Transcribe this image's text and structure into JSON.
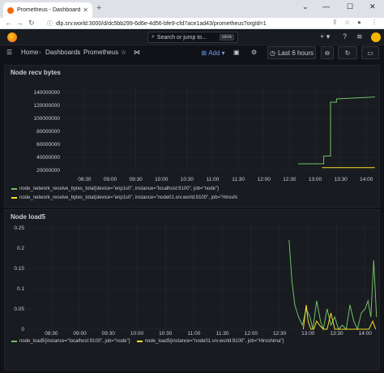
{
  "browser": {
    "tab_title": "Prometheus - Dashboards - Graf",
    "url": "dlp.srv.world:3000/d/dc5bb299-6d6e-4d56-bfe9-cfd7ace1ad43/prometheus?orgId=1"
  },
  "topbar": {
    "search_placeholder": "Search or jump to...",
    "search_shortcut": "ctrl+k"
  },
  "navbar": {
    "breadcrumb_home": "Home",
    "breadcrumb_dashboards": "Dashboards",
    "breadcrumb_current": "Prometheus",
    "add_label": "Add",
    "time_range": "Last 6 hours"
  },
  "panels": [
    {
      "title": "Node recv bytes",
      "legend": [
        "node_network_receive_bytes_total{device=\"enp1s0\", instance=\"localhost:9100\", job=\"node\"}",
        "node_network_receive_bytes_total{device=\"enp1s0\", instance=\"node01.srv.world:9100\", job=\"Hiroshi"
      ]
    },
    {
      "title": "Node load5",
      "legend": [
        "node_load5{instance=\"localhost:9100\", job=\"node\"}",
        "node_load5{instance=\"node01.srv.world:9100\", job=\"Hiroshima\"}"
      ]
    }
  ],
  "colors": {
    "series_green": "#73bf69",
    "series_yellow": "#fade2a",
    "accent": "#6e9fff"
  },
  "chart_data": [
    {
      "type": "line",
      "title": "Node recv bytes",
      "x_ticks": [
        "08:30",
        "09:00",
        "09:30",
        "10:00",
        "10:30",
        "11:00",
        "11:30",
        "12:00",
        "12:30",
        "13:00",
        "13:30",
        "14:00"
      ],
      "y_ticks": [
        "20000000",
        "40000000",
        "60000000",
        "80000000",
        "100000000",
        "120000000",
        "140000000"
      ],
      "ylim": [
        13000000,
        145000000
      ],
      "xlim": [
        "08:05",
        "14:13"
      ],
      "series": [
        {
          "name": "node_network_receive_bytes_total{device=\"enp1s0\", instance=\"localhost:9100\", job=\"node\"}",
          "color": "#73bf69",
          "x": [
            "12:40",
            "13:10",
            "13:10",
            "13:18",
            "13:18",
            "13:25",
            "13:25",
            "14:10"
          ],
          "values": [
            30000000,
            30000000,
            42000000,
            42000000,
            125000000,
            125000000,
            130000000,
            133000000
          ]
        },
        {
          "name": "node_network_receive_bytes_total{device=\"enp1s0\", instance=\"node01.srv.world:9100\", job=\"Hiroshi",
          "color": "#fade2a",
          "x": [
            "13:08",
            "14:10"
          ],
          "values": [
            24000000,
            24000000
          ]
        }
      ]
    },
    {
      "type": "line",
      "title": "Node load5",
      "x_ticks": [
        "08:30",
        "09:00",
        "09:30",
        "10:00",
        "10:30",
        "11:00",
        "11:30",
        "12:00",
        "12:30",
        "13:00",
        "13:30",
        "14:00"
      ],
      "y_ticks": [
        "0",
        "0.05",
        "0.1",
        "0.15",
        "0.2",
        "0.25"
      ],
      "ylim": [
        0,
        0.25
      ],
      "xlim": [
        "08:05",
        "14:13"
      ],
      "series": [
        {
          "name": "node_load5{instance=\"localhost:9100\", job=\"node\"}",
          "color": "#73bf69",
          "x": [
            "12:40",
            "12:43",
            "12:46",
            "12:50",
            "12:54",
            "12:58",
            "13:02",
            "13:05",
            "13:09",
            "13:13",
            "13:16",
            "13:20",
            "13:24",
            "13:28",
            "13:32",
            "13:36",
            "13:40",
            "13:44",
            "13:48",
            "13:52",
            "13:56",
            "14:00",
            "14:03",
            "14:06",
            "14:09",
            "14:12"
          ],
          "values": [
            0.22,
            0.12,
            0.06,
            0.03,
            0.01,
            0.05,
            0.03,
            0.0,
            0.07,
            0.02,
            0.0,
            0.05,
            0.01,
            0.03,
            0.0,
            0.01,
            0.0,
            0.06,
            0.02,
            0.0,
            0.04,
            0.05,
            0.07,
            0.03,
            0.17,
            0.03
          ]
        },
        {
          "name": "node_load5{instance=\"node01.srv.world:9100\", job=\"Hiroshima\"}",
          "color": "#fade2a",
          "x": [
            "12:55",
            "12:58",
            "13:00",
            "13:03",
            "13:06",
            "13:09",
            "13:12",
            "13:16",
            "13:20",
            "13:24",
            "13:28",
            "13:32",
            "13:36",
            "13:40",
            "13:45",
            "13:50",
            "13:55",
            "14:00",
            "14:04",
            "14:08",
            "14:11"
          ],
          "values": [
            0.0,
            0.06,
            0.02,
            0.0,
            0.0,
            0.02,
            0.01,
            0.0,
            0.0,
            0.04,
            0.0,
            0.0,
            0.0,
            0.0,
            0.0,
            0.0,
            0.0,
            0.0,
            0.0,
            0.02,
            0.0
          ]
        }
      ]
    }
  ]
}
